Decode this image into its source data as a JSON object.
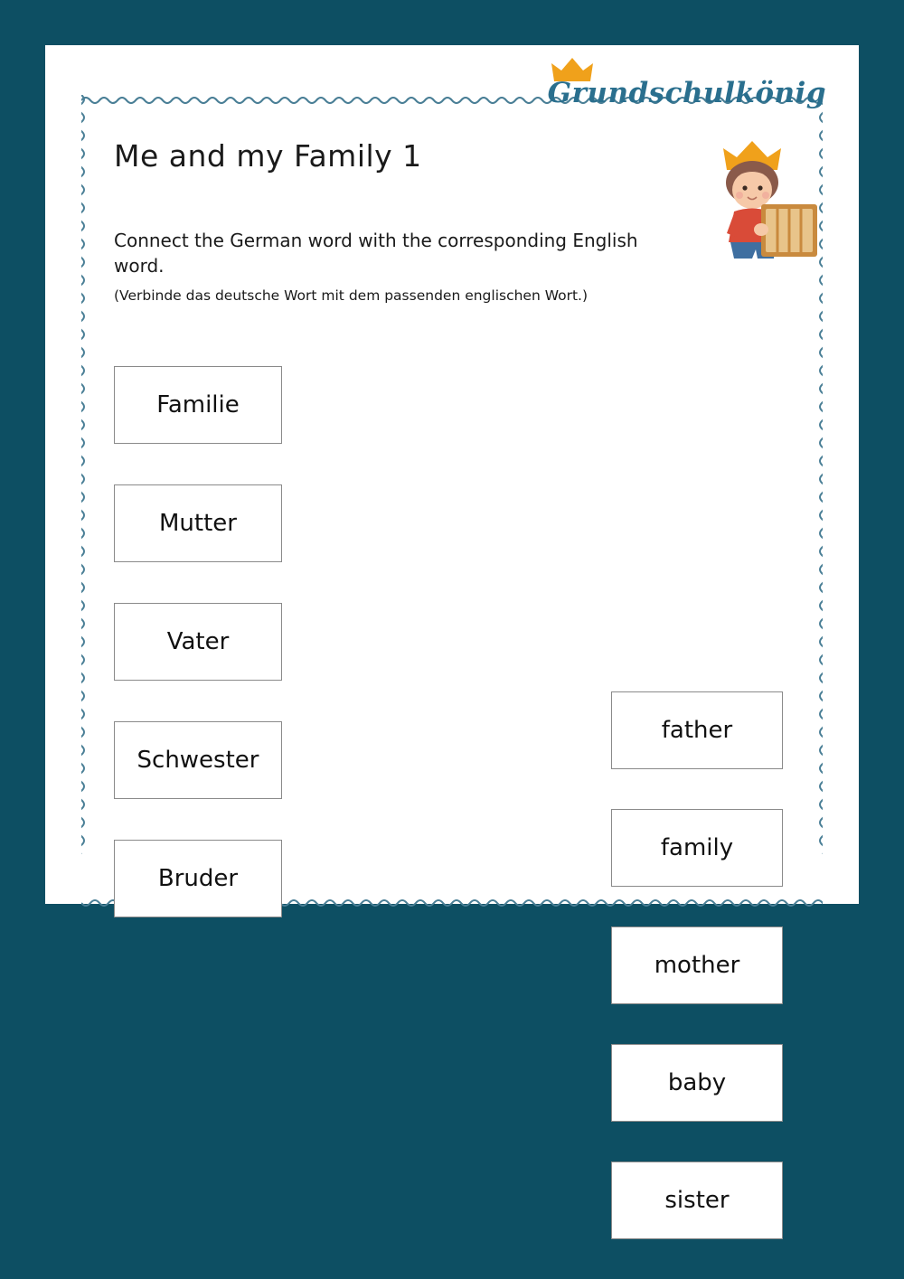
{
  "theme": {
    "background": "#0d4f63",
    "page": "#ffffff",
    "logo_color": "#2a6f8e",
    "crown_color": "#f0a11b",
    "border_color": "#4a7f96"
  },
  "logo": {
    "text": "Grundschulkönig",
    "crown_icon": "crown-icon"
  },
  "worksheet": {
    "title": "Me and my Family 1",
    "instruction": "Connect the German word with the corresponding English word.",
    "instruction_german": "(Verbinde das deutsche Wort mit dem passenden englischen Wort.)"
  },
  "mascot": {
    "name": "boy-with-crown-and-book"
  },
  "columns": {
    "german_words": [
      "Familie",
      "Mutter",
      "Vater",
      "Schwester",
      "Bruder"
    ],
    "english_words": [
      "father",
      "family",
      "mother",
      "baby",
      "sister"
    ]
  }
}
